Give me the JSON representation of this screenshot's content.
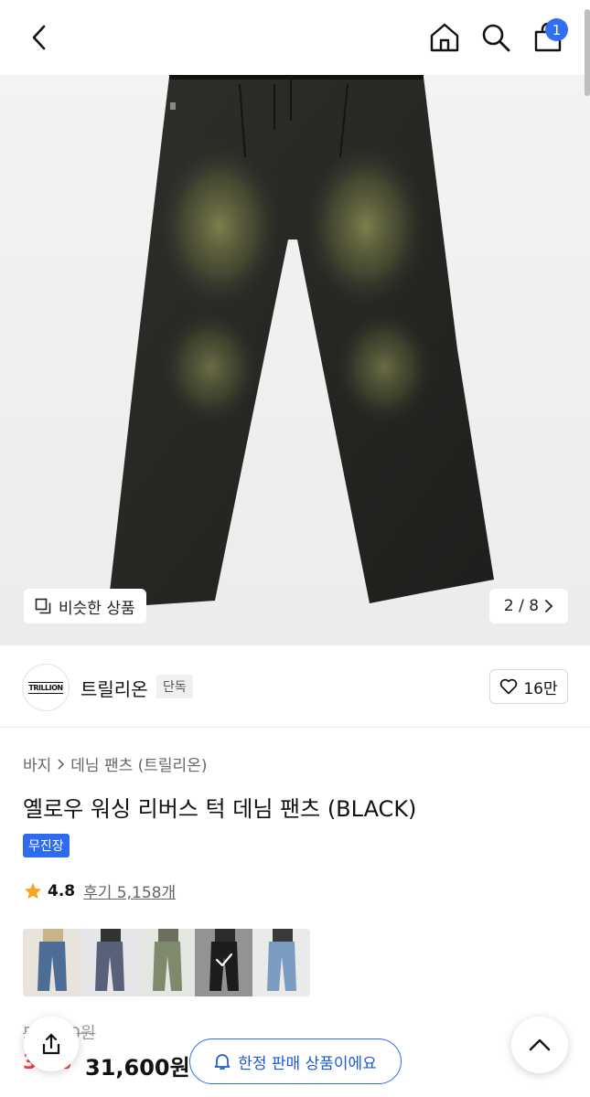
{
  "header": {
    "back_icon": "chevron-left-icon",
    "home_icon": "home-icon",
    "search_icon": "search-icon",
    "cart_icon": "cart-icon",
    "cart_count": "1"
  },
  "gallery": {
    "similar_label": "비슷한 상품",
    "counter": "2 / 8",
    "current_index": 2,
    "total": 8
  },
  "brand": {
    "logo_text": "TRILLION",
    "name": "트릴리온",
    "tag": "단독",
    "likes": "16만"
  },
  "product": {
    "breadcrumb": [
      "바지",
      "데님 팬츠 (트릴리온)"
    ],
    "title": "옐로우 워싱 리버스 턱 데님 팬츠 (BLACK)",
    "label": "무진장",
    "rating": "4.8",
    "reviews": "후기 5,158개",
    "original_price": "51,000원",
    "discount": "38%",
    "price": "31,600원"
  },
  "colors": {
    "swatches": [
      "blue",
      "dark-blue",
      "green-wash",
      "black",
      "light-blue"
    ],
    "selected_index": 3
  },
  "footer": {
    "share_icon": "share-icon",
    "limited_label": "한정 판매 상품이에요",
    "bell_icon": "bell-icon",
    "top_icon": "chevron-up-icon"
  },
  "theme": {
    "accent": "#2d6cf0",
    "sale": "#f43d3d"
  }
}
